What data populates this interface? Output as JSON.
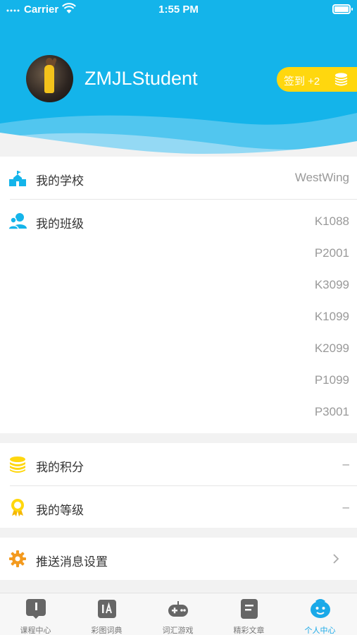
{
  "status_bar": {
    "carrier": "Carrier",
    "time": "1:55 PM"
  },
  "profile": {
    "username": "ZMJLStudent"
  },
  "checkin": {
    "label": "签到 +2"
  },
  "school": {
    "label": "我的学校",
    "value": "WestWing"
  },
  "classes": {
    "label": "我的班级",
    "values": [
      "K1088",
      "P2001",
      "K3099",
      "K1099",
      "K2099",
      "P1099",
      "P3001"
    ]
  },
  "points": {
    "label": "我的积分",
    "value": "–"
  },
  "level": {
    "label": "我的等级",
    "value": "–"
  },
  "push": {
    "label": "推送消息设置"
  },
  "tabs": [
    {
      "label": "课程中心",
      "icon": "course-icon"
    },
    {
      "label": "彩图词典",
      "icon": "dictionary-icon"
    },
    {
      "label": "词汇游戏",
      "icon": "gamepad-icon"
    },
    {
      "label": "精彩文章",
      "icon": "article-icon"
    },
    {
      "label": "个人中心",
      "icon": "profile-face-icon"
    }
  ],
  "colors": {
    "header": "#14b4ea",
    "accent": "#1aa9e8",
    "coin": "#ffd70e",
    "gear": "#f39a1e"
  }
}
